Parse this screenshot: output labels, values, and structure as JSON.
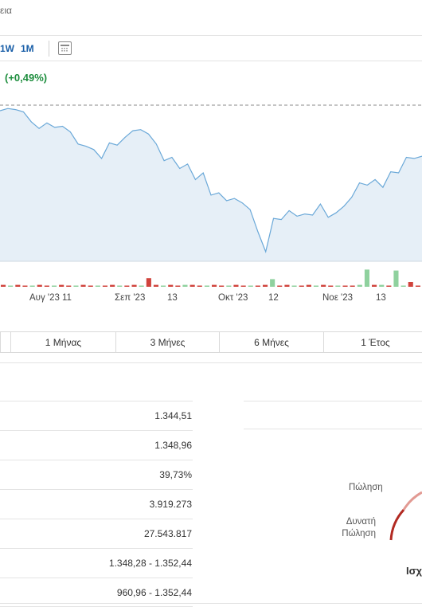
{
  "breadcrumb": {
    "text": "εια"
  },
  "toolbar": {
    "timeframes": [
      "1W",
      "1M"
    ],
    "calendar_icon": "calendar-icon"
  },
  "quote": {
    "change_percent": "(+0,49%)",
    "change_color": "#1e8e3e"
  },
  "chart_data": {
    "type": "area",
    "series": [
      {
        "values": [
          1347,
          1349,
          1348,
          1346,
          1337,
          1331,
          1336,
          1332,
          1333,
          1328,
          1317,
          1315,
          1312,
          1304,
          1318,
          1316,
          1323,
          1329,
          1330,
          1326,
          1317,
          1302,
          1305,
          1295,
          1299,
          1285,
          1291,
          1271,
          1273,
          1266,
          1268,
          1264,
          1258,
          1238,
          1220,
          1250,
          1249,
          1257,
          1252,
          1254,
          1253,
          1263,
          1251,
          1255,
          1261,
          1269,
          1282,
          1280,
          1285,
          1278,
          1292,
          1291,
          1305,
          1304,
          1306
        ]
      }
    ],
    "volume": [
      2,
      1,
      2,
      1,
      1,
      2,
      1,
      1,
      2,
      1,
      1,
      2,
      1,
      1,
      1,
      2,
      1,
      1,
      2,
      1,
      9,
      2,
      1,
      2,
      1,
      2,
      2,
      1,
      1,
      2,
      1,
      1,
      2,
      1,
      1,
      1,
      2,
      8,
      1,
      2,
      1,
      1,
      2,
      1,
      2,
      1,
      1,
      1,
      1,
      2,
      18,
      2,
      2,
      1,
      17,
      1,
      5,
      1
    ],
    "x_tick_labels": [
      "Αυγ '23",
      "11",
      "Σεπ '23",
      "13",
      "Οκτ '23",
      "12",
      "Νοε '23",
      "13"
    ],
    "line_color": "#6aa8d8",
    "fill_color": "#e6eff7",
    "up_color": "#8fd19e",
    "down_color": "#d0433c"
  },
  "ranges": {
    "items": [
      "1 Μήνας",
      "3 Μήνες",
      "6 Μήνες",
      "1 Έτος"
    ]
  },
  "stats": {
    "values": [
      "1.344,51",
      "1.348,96",
      "39,73%",
      "3.919.273",
      "27.543.817",
      "1.348,28 - 1.352,44",
      "960,96 - 1.352,44"
    ]
  },
  "gauge": {
    "sell_label": "Πώληση",
    "strong_sell_label": "Δυνατή\nΠώληση",
    "summary_label": "Ισχ"
  }
}
